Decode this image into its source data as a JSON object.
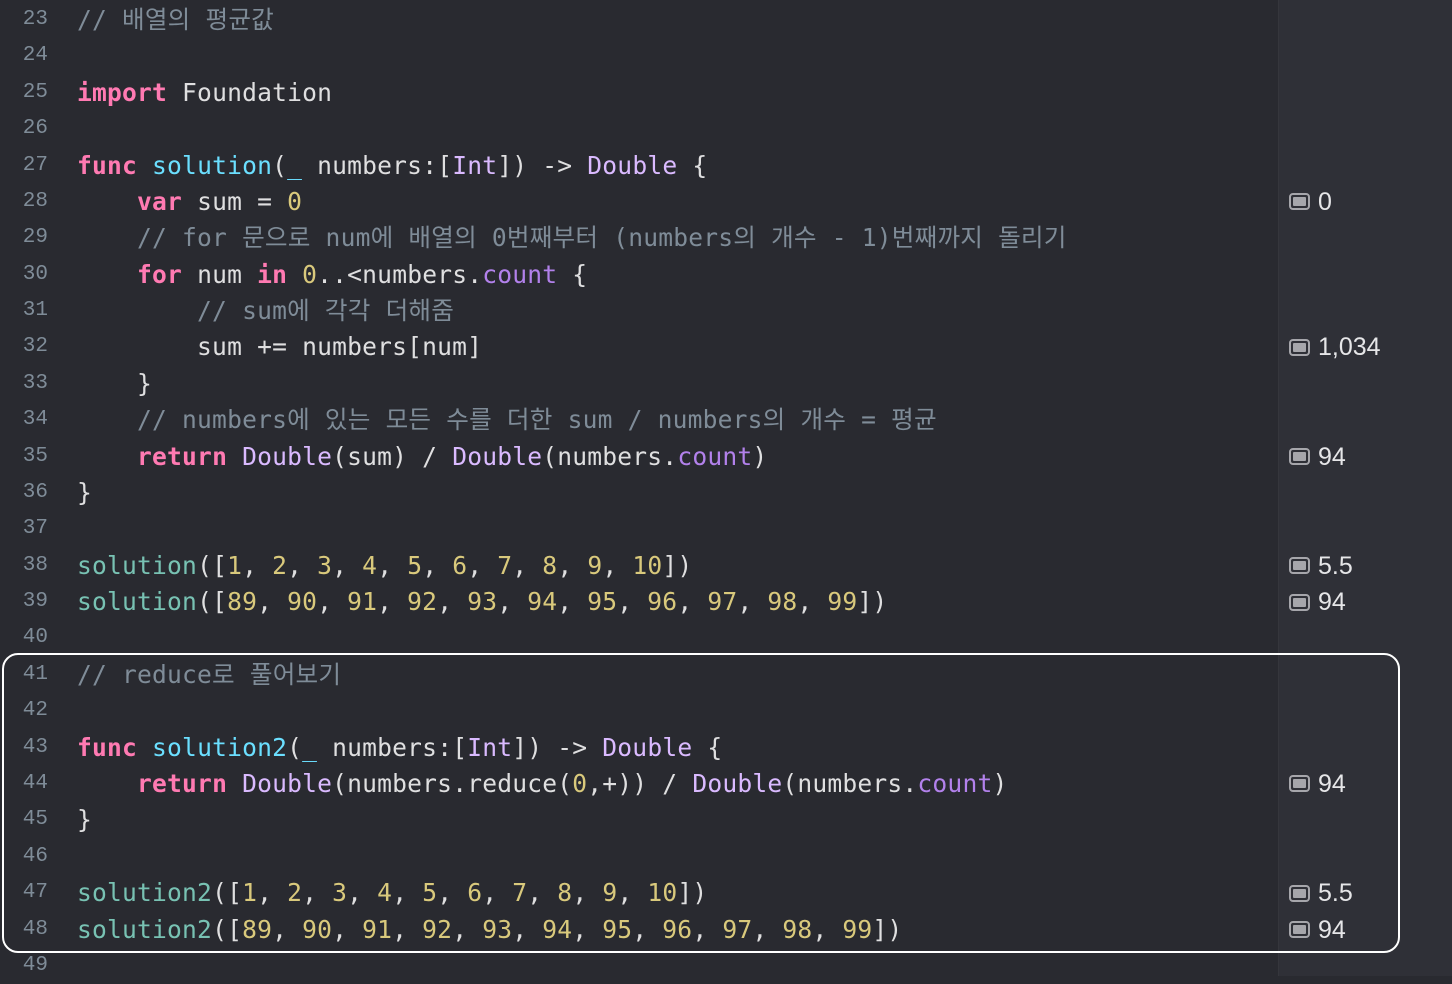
{
  "lines": [
    {
      "number": "23",
      "tokens": [
        {
          "t": "// 배열의 평균값",
          "k": "comment"
        }
      ]
    },
    {
      "number": "24",
      "tokens": []
    },
    {
      "number": "25",
      "tokens": [
        {
          "t": "import",
          "k": "keyword"
        },
        {
          "t": " Foundation",
          "k": "plain"
        }
      ]
    },
    {
      "number": "26",
      "tokens": []
    },
    {
      "number": "27",
      "tokens": [
        {
          "t": "func",
          "k": "keyword"
        },
        {
          "t": " ",
          "k": "plain"
        },
        {
          "t": "solution",
          "k": "func"
        },
        {
          "t": "(",
          "k": "plain"
        },
        {
          "t": "_",
          "k": "func"
        },
        {
          "t": " numbers:[",
          "k": "plain"
        },
        {
          "t": "Int",
          "k": "type"
        },
        {
          "t": "]) -> ",
          "k": "plain"
        },
        {
          "t": "Double",
          "k": "type"
        },
        {
          "t": " {",
          "k": "plain"
        }
      ]
    },
    {
      "number": "28",
      "tokens": [
        {
          "t": "    ",
          "k": "plain"
        },
        {
          "t": "var",
          "k": "keyword"
        },
        {
          "t": " sum = ",
          "k": "plain"
        },
        {
          "t": "0",
          "k": "number"
        }
      ]
    },
    {
      "number": "29",
      "tokens": [
        {
          "t": "    // for 문으로 num에 배열의 0번째부터 (numbers의 개수 - 1)번째까지 돌리기",
          "k": "comment"
        }
      ]
    },
    {
      "number": "30",
      "tokens": [
        {
          "t": "    ",
          "k": "plain"
        },
        {
          "t": "for",
          "k": "keyword"
        },
        {
          "t": " num ",
          "k": "plain"
        },
        {
          "t": "in",
          "k": "keyword"
        },
        {
          "t": " ",
          "k": "plain"
        },
        {
          "t": "0",
          "k": "number"
        },
        {
          "t": "..<numbers.",
          "k": "plain"
        },
        {
          "t": "count",
          "k": "prop"
        },
        {
          "t": " {",
          "k": "plain"
        }
      ]
    },
    {
      "number": "31",
      "tokens": [
        {
          "t": "        // sum에 각각 더해줌",
          "k": "comment"
        }
      ]
    },
    {
      "number": "32",
      "tokens": [
        {
          "t": "        sum += numbers[num]",
          "k": "plain"
        }
      ]
    },
    {
      "number": "33",
      "tokens": [
        {
          "t": "    }",
          "k": "plain"
        }
      ]
    },
    {
      "number": "34",
      "tokens": [
        {
          "t": "    // numbers에 있는 모든 수를 더한 sum / numbers의 개수 = 평균",
          "k": "comment"
        }
      ]
    },
    {
      "number": "35",
      "tokens": [
        {
          "t": "    ",
          "k": "plain"
        },
        {
          "t": "return",
          "k": "keyword"
        },
        {
          "t": " ",
          "k": "plain"
        },
        {
          "t": "Double",
          "k": "type"
        },
        {
          "t": "(sum) / ",
          "k": "plain"
        },
        {
          "t": "Double",
          "k": "type"
        },
        {
          "t": "(numbers.",
          "k": "plain"
        },
        {
          "t": "count",
          "k": "prop"
        },
        {
          "t": ")",
          "k": "plain"
        }
      ]
    },
    {
      "number": "36",
      "tokens": [
        {
          "t": "}",
          "k": "plain"
        }
      ]
    },
    {
      "number": "37",
      "tokens": []
    },
    {
      "number": "38",
      "tokens": [
        {
          "t": "solution",
          "k": "call"
        },
        {
          "t": "([",
          "k": "plain"
        },
        {
          "t": "1",
          "k": "number"
        },
        {
          "t": ", ",
          "k": "plain"
        },
        {
          "t": "2",
          "k": "number"
        },
        {
          "t": ", ",
          "k": "plain"
        },
        {
          "t": "3",
          "k": "number"
        },
        {
          "t": ", ",
          "k": "plain"
        },
        {
          "t": "4",
          "k": "number"
        },
        {
          "t": ", ",
          "k": "plain"
        },
        {
          "t": "5",
          "k": "number"
        },
        {
          "t": ", ",
          "k": "plain"
        },
        {
          "t": "6",
          "k": "number"
        },
        {
          "t": ", ",
          "k": "plain"
        },
        {
          "t": "7",
          "k": "number"
        },
        {
          "t": ", ",
          "k": "plain"
        },
        {
          "t": "8",
          "k": "number"
        },
        {
          "t": ", ",
          "k": "plain"
        },
        {
          "t": "9",
          "k": "number"
        },
        {
          "t": ", ",
          "k": "plain"
        },
        {
          "t": "10",
          "k": "number"
        },
        {
          "t": "])",
          "k": "plain"
        }
      ]
    },
    {
      "number": "39",
      "tokens": [
        {
          "t": "solution",
          "k": "call"
        },
        {
          "t": "([",
          "k": "plain"
        },
        {
          "t": "89",
          "k": "number"
        },
        {
          "t": ", ",
          "k": "plain"
        },
        {
          "t": "90",
          "k": "number"
        },
        {
          "t": ", ",
          "k": "plain"
        },
        {
          "t": "91",
          "k": "number"
        },
        {
          "t": ", ",
          "k": "plain"
        },
        {
          "t": "92",
          "k": "number"
        },
        {
          "t": ", ",
          "k": "plain"
        },
        {
          "t": "93",
          "k": "number"
        },
        {
          "t": ", ",
          "k": "plain"
        },
        {
          "t": "94",
          "k": "number"
        },
        {
          "t": ", ",
          "k": "plain"
        },
        {
          "t": "95",
          "k": "number"
        },
        {
          "t": ", ",
          "k": "plain"
        },
        {
          "t": "96",
          "k": "number"
        },
        {
          "t": ", ",
          "k": "plain"
        },
        {
          "t": "97",
          "k": "number"
        },
        {
          "t": ", ",
          "k": "plain"
        },
        {
          "t": "98",
          "k": "number"
        },
        {
          "t": ", ",
          "k": "plain"
        },
        {
          "t": "99",
          "k": "number"
        },
        {
          "t": "])",
          "k": "plain"
        }
      ]
    },
    {
      "number": "40",
      "tokens": []
    },
    {
      "number": "41",
      "tokens": [
        {
          "t": "// reduce로 풀어보기",
          "k": "comment"
        }
      ]
    },
    {
      "number": "42",
      "tokens": []
    },
    {
      "number": "43",
      "tokens": [
        {
          "t": "func",
          "k": "keyword"
        },
        {
          "t": " ",
          "k": "plain"
        },
        {
          "t": "solution2",
          "k": "func"
        },
        {
          "t": "(",
          "k": "plain"
        },
        {
          "t": "_",
          "k": "func"
        },
        {
          "t": " numbers:[",
          "k": "plain"
        },
        {
          "t": "Int",
          "k": "type"
        },
        {
          "t": "]) -> ",
          "k": "plain"
        },
        {
          "t": "Double",
          "k": "type"
        },
        {
          "t": " {",
          "k": "plain"
        }
      ]
    },
    {
      "number": "44",
      "tokens": [
        {
          "t": "    ",
          "k": "plain"
        },
        {
          "t": "return",
          "k": "keyword"
        },
        {
          "t": " ",
          "k": "plain"
        },
        {
          "t": "Double",
          "k": "type"
        },
        {
          "t": "(numbers.reduce(",
          "k": "plain"
        },
        {
          "t": "0",
          "k": "number"
        },
        {
          "t": ",+)) / ",
          "k": "plain"
        },
        {
          "t": "Double",
          "k": "type"
        },
        {
          "t": "(numbers.",
          "k": "plain"
        },
        {
          "t": "count",
          "k": "prop"
        },
        {
          "t": ")",
          "k": "plain"
        }
      ]
    },
    {
      "number": "45",
      "tokens": [
        {
          "t": "}",
          "k": "plain"
        }
      ]
    },
    {
      "number": "46",
      "tokens": []
    },
    {
      "number": "47",
      "tokens": [
        {
          "t": "solution2",
          "k": "call"
        },
        {
          "t": "([",
          "k": "plain"
        },
        {
          "t": "1",
          "k": "number"
        },
        {
          "t": ", ",
          "k": "plain"
        },
        {
          "t": "2",
          "k": "number"
        },
        {
          "t": ", ",
          "k": "plain"
        },
        {
          "t": "3",
          "k": "number"
        },
        {
          "t": ", ",
          "k": "plain"
        },
        {
          "t": "4",
          "k": "number"
        },
        {
          "t": ", ",
          "k": "plain"
        },
        {
          "t": "5",
          "k": "number"
        },
        {
          "t": ", ",
          "k": "plain"
        },
        {
          "t": "6",
          "k": "number"
        },
        {
          "t": ", ",
          "k": "plain"
        },
        {
          "t": "7",
          "k": "number"
        },
        {
          "t": ", ",
          "k": "plain"
        },
        {
          "t": "8",
          "k": "number"
        },
        {
          "t": ", ",
          "k": "plain"
        },
        {
          "t": "9",
          "k": "number"
        },
        {
          "t": ", ",
          "k": "plain"
        },
        {
          "t": "10",
          "k": "number"
        },
        {
          "t": "])",
          "k": "plain"
        }
      ]
    },
    {
      "number": "48",
      "tokens": [
        {
          "t": "solution2",
          "k": "call"
        },
        {
          "t": "([",
          "k": "plain"
        },
        {
          "t": "89",
          "k": "number"
        },
        {
          "t": ", ",
          "k": "plain"
        },
        {
          "t": "90",
          "k": "number"
        },
        {
          "t": ", ",
          "k": "plain"
        },
        {
          "t": "91",
          "k": "number"
        },
        {
          "t": ", ",
          "k": "plain"
        },
        {
          "t": "92",
          "k": "number"
        },
        {
          "t": ", ",
          "k": "plain"
        },
        {
          "t": "93",
          "k": "number"
        },
        {
          "t": ", ",
          "k": "plain"
        },
        {
          "t": "94",
          "k": "number"
        },
        {
          "t": ", ",
          "k": "plain"
        },
        {
          "t": "95",
          "k": "number"
        },
        {
          "t": ", ",
          "k": "plain"
        },
        {
          "t": "96",
          "k": "number"
        },
        {
          "t": ", ",
          "k": "plain"
        },
        {
          "t": "97",
          "k": "number"
        },
        {
          "t": ", ",
          "k": "plain"
        },
        {
          "t": "98",
          "k": "number"
        },
        {
          "t": ", ",
          "k": "plain"
        },
        {
          "t": "99",
          "k": "number"
        },
        {
          "t": "])",
          "k": "plain"
        }
      ]
    },
    {
      "number": "49",
      "tokens": []
    }
  ],
  "results": [
    {
      "line": "28",
      "value": "0"
    },
    {
      "line": "32",
      "value": "1,034"
    },
    {
      "line": "35",
      "value": "94"
    },
    {
      "line": "38",
      "value": "5.5"
    },
    {
      "line": "39",
      "value": "94"
    },
    {
      "line": "44",
      "value": "94"
    },
    {
      "line": "47",
      "value": "5.5"
    },
    {
      "line": "48",
      "value": "94"
    }
  ],
  "theme_colors": {
    "background": "#292a30",
    "sidebar": "#2f3037",
    "keyword": "#ff7ab2",
    "type": "#dabaff",
    "declaration": "#6bdfff",
    "call": "#78c2b3",
    "property": "#b281eb",
    "number": "#d9c97c",
    "comment": "#7f8c98",
    "highlight_border": "#ffffff"
  }
}
